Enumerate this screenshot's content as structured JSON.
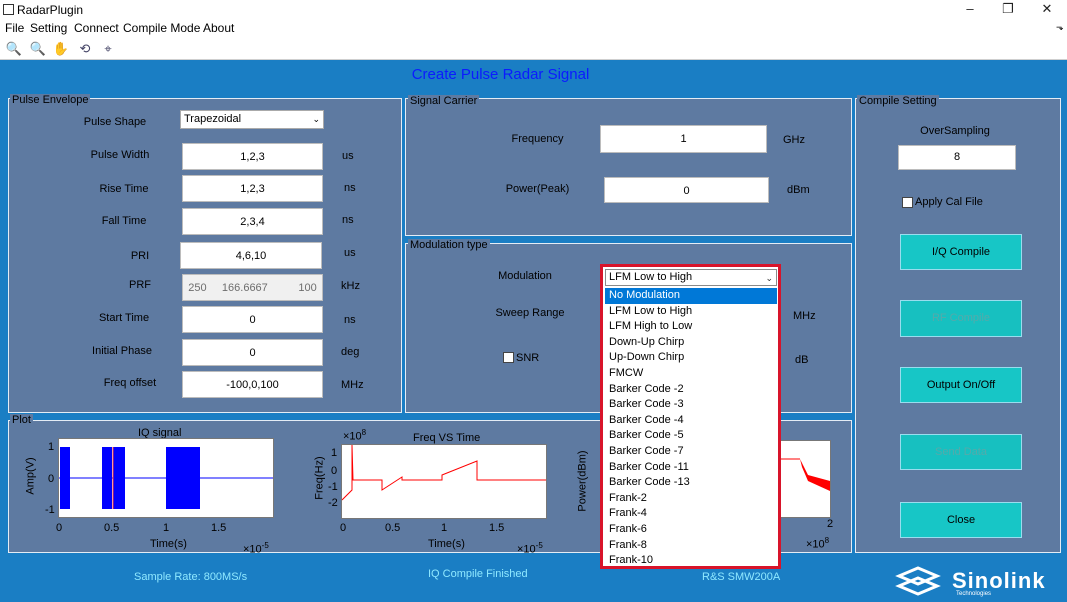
{
  "window": {
    "title": "RadarPlugin",
    "min": "–",
    "max": "❐",
    "close": "✕"
  },
  "menu": [
    "File",
    "Setting",
    "Connect",
    "Compile Mode",
    "About"
  ],
  "header": "Create Pulse Radar Signal",
  "pulse_envelope": {
    "title": "Pulse Envelope",
    "shape_label": "Pulse Shape",
    "shape_value": "Trapezoidal",
    "rows": [
      {
        "label": "Pulse Width",
        "value": "1,2,3",
        "unit": "us"
      },
      {
        "label": "Rise Time",
        "value": "1,2,3",
        "unit": "ns"
      },
      {
        "label": "Fall Time",
        "value": "2,3,4",
        "unit": "ns"
      },
      {
        "label": "PRI",
        "value": "4,6,10",
        "unit": "us"
      },
      {
        "label": "PRF",
        "value": "250     166.6667          100",
        "unit": "kHz"
      },
      {
        "label": "Start Time",
        "value": "0",
        "unit": "ns"
      },
      {
        "label": "Initial Phase",
        "value": "0",
        "unit": "deg"
      },
      {
        "label": "Freq offset",
        "value": "-100,0,100",
        "unit": "MHz"
      }
    ]
  },
  "signal_carrier": {
    "title": "Signal  Carrier",
    "freq_label": "Frequency",
    "freq_value": "1",
    "freq_unit": "GHz",
    "power_label": "Power(Peak)",
    "power_value": "0",
    "power_unit": "dBm"
  },
  "modulation": {
    "title": "Modulation type",
    "mod_label": "Modulation",
    "sweep_label": "Sweep Range",
    "sweep_unit": "MHz",
    "snr_label": "SNR",
    "snr_unit": "dB",
    "selected": "LFM Low to High",
    "options": [
      "No Modulation",
      "LFM Low to High",
      "LFM High to Low",
      "Down-Up Chirp",
      "Up-Down Chirp",
      "FMCW",
      "Barker Code -2",
      "Barker Code -3",
      "Barker Code -4",
      "Barker Code -5",
      "Barker Code -7",
      "Barker Code -11",
      "Barker Code -13",
      "Frank-2",
      "Frank-4",
      "Frank-6",
      "Frank-8",
      "Frank-10"
    ]
  },
  "compile": {
    "title": "Compile Setting",
    "oversampling_label": "OverSampling",
    "oversampling_value": "8",
    "cal_label": "Apply Cal File",
    "buttons": [
      "I/Q Compile",
      "RF Compile",
      "Output On/Off",
      "Send Data",
      "Close"
    ]
  },
  "plot": {
    "title": "Plot",
    "iq": {
      "title": "IQ signal",
      "ylabel": "Amp(V)",
      "xlabel": "Time(s)",
      "exp": "×10",
      "exp_pow": "-5",
      "yticks": [
        "1",
        "0",
        "-1"
      ],
      "xticks": [
        "0",
        "0.5",
        "1",
        "1.5"
      ]
    },
    "freq": {
      "title": "Freq VS Time",
      "ylabel": "Freq(Hz)",
      "xlabel": "Time(s)",
      "exp": "×10",
      "exp_pow": "-5",
      "yexp": "×10",
      "yexp_pow": "8",
      "yticks": [
        "1",
        "0",
        "-1",
        "-2"
      ],
      "xticks": [
        "0",
        "0.5",
        "1",
        "1.5"
      ]
    },
    "power": {
      "ylabel": "Power(dBm)",
      "xexp": "×10",
      "xexp_pow": "8",
      "xtick": "2"
    }
  },
  "status": {
    "sample_rate": "Sample Rate: 800MS/s",
    "compile_status": "IQ Compile Finished",
    "instrument": "R&S SMW200A"
  },
  "logo": {
    "text": "Sinolink",
    "sub": "Technologies"
  }
}
